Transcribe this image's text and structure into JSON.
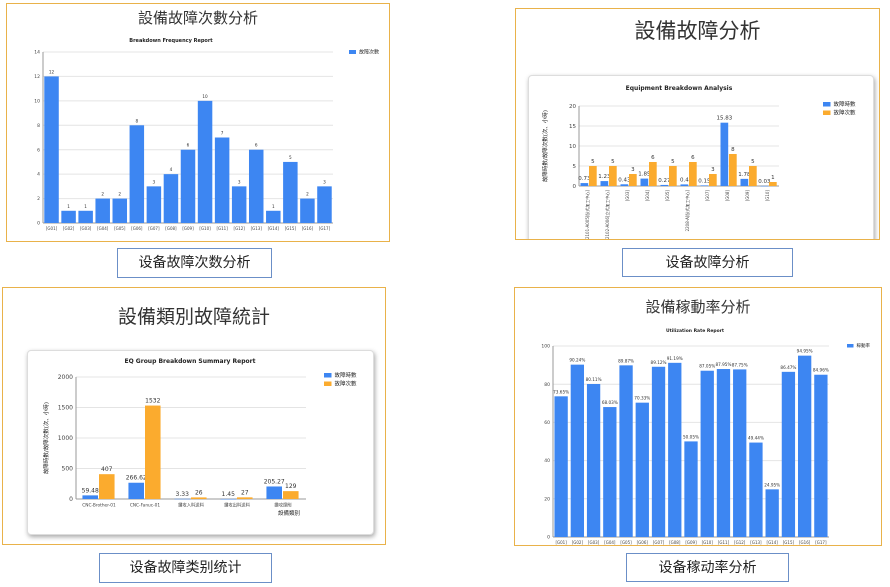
{
  "panels": [
    {
      "heading": "設備故障次數分析",
      "caption": "设备故障次数分析",
      "chart_data": {
        "type": "bar",
        "title": "Breakdown Frequency Report",
        "ylim": [
          0,
          14
        ],
        "yticks": [
          0,
          2,
          4,
          6,
          8,
          10,
          12,
          14
        ],
        "categories": [
          "[G01]",
          "[G02]",
          "[G03]",
          "[G04]",
          "[G05]",
          "[G06]",
          "[G07]",
          "[G08]",
          "[G09]",
          "[G10]",
          "[G11]",
          "[G12]",
          "[G13]",
          "[G14]",
          "[G15]",
          "[G16]",
          "[G17]"
        ],
        "series": [
          {
            "name": "故障次數",
            "color": "#3d86f2",
            "values": [
              12,
              1,
              1,
              2,
              2,
              8,
              3,
              4,
              6,
              10,
              7,
              3,
              6,
              1,
              5,
              2,
              3
            ]
          }
        ],
        "legend": "top-right",
        "grid": true
      }
    },
    {
      "heading": "設備故障分析",
      "caption": "设备故障分析",
      "chart_data": {
        "type": "bar",
        "title": "Equipment Breakdown Analysis",
        "ylabel": "故障時數/故障次數(次、小時)",
        "ylim": [
          0,
          20
        ],
        "yticks": [
          0,
          5,
          10,
          15,
          20
        ],
        "categories": [
          "2101-A005[臥式加工中心]",
          "2102-A006[立式加工中心]",
          "[G03]",
          "[G04]",
          "[G05]",
          "2208-A[臥式加工中心]",
          "[G07]",
          "[G08]",
          "[G09]",
          "[G10]"
        ],
        "series": [
          {
            "name": "故障時數",
            "color": "#3d86f2",
            "values": [
              0.73,
              1.23,
              0.43,
              1.85,
              0.27,
              0.4,
              0.15,
              15.83,
              1.78,
              0.03
            ]
          },
          {
            "name": "故障次數",
            "color": "#fbab2e",
            "values": [
              5,
              5,
              3,
              6,
              5,
              6,
              3,
              8,
              5,
              1
            ]
          }
        ],
        "legend": "top-right",
        "grid": true
      }
    },
    {
      "heading": "設備類別故障統計",
      "caption": "设备故障类别统计",
      "chart_data": {
        "type": "bar",
        "title": "EQ Group Breakdown Summary Report",
        "ylabel": "故障時數/故障次數(次、小時)",
        "xlabel": "設備類別",
        "ylim": [
          0,
          2000
        ],
        "yticks": [
          0,
          500,
          1000,
          1500,
          2000
        ],
        "categories": [
          "CNC-Brother-01",
          "CNC-Fanuc-01",
          "鑽攻入料送料",
          "鑽攻出料送料",
          "鑽攻鏜削"
        ],
        "series": [
          {
            "name": "故障時數",
            "color": "#3d86f2",
            "values": [
              59.48,
              266.62,
              3.33,
              1.45,
              205.27
            ]
          },
          {
            "name": "故障次數",
            "color": "#fbab2e",
            "values": [
              407,
              1532,
              26,
              27,
              129
            ]
          }
        ],
        "legend": "top-right",
        "grid": true
      }
    },
    {
      "heading": "設備稼動率分析",
      "caption": "设备稼动率分析",
      "chart_data": {
        "type": "bar",
        "title": "Utilization Rate Report",
        "ylim": [
          0,
          100
        ],
        "yticks": [
          0,
          20,
          40,
          60,
          80,
          100
        ],
        "categories": [
          "[G01]",
          "[G02]",
          "[G03]",
          "[G04]",
          "[G05]",
          "[G06]",
          "[G07]",
          "[G08]",
          "[G09]",
          "[G10]",
          "[G11]",
          "[G12]",
          "[G13]",
          "[G14]",
          "[G15]",
          "[G16]",
          "[G17]"
        ],
        "value_labels": [
          "73.65%",
          "90.24%",
          "80.11%",
          "68.03%",
          "89.87%",
          "70.33%",
          "89.12%",
          "91.19%",
          "50.05%",
          "87.05%",
          "87.95%",
          "87.75%",
          "49.44%",
          "24.95%",
          "86.47%",
          "94.95%",
          "84.96%"
        ],
        "series": [
          {
            "name": "稼動率",
            "color": "#3d86f2",
            "values": [
              73.65,
              90.24,
              80.11,
              68.03,
              89.87,
              70.33,
              89.12,
              91.19,
              50.05,
              87.05,
              87.95,
              87.75,
              49.44,
              24.95,
              86.47,
              94.95,
              84.96
            ]
          }
        ],
        "legend": "top-right",
        "grid": true
      }
    }
  ]
}
